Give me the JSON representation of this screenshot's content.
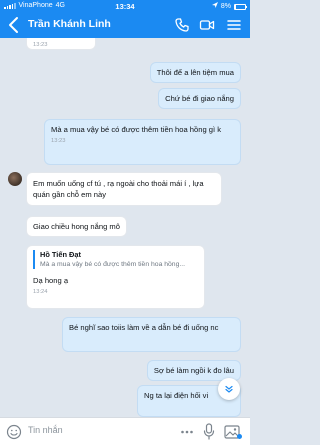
{
  "status_bar": {
    "carrier": "VinaPhone",
    "network": "4G",
    "time": "13:34",
    "battery": "8%",
    "battery_level": 0.08
  },
  "header": {
    "contact_name": "Trần Khánh Linh"
  },
  "messages": [
    {
      "text": "",
      "time": "13:23"
    },
    {
      "text": "Thôi để a lên tiệm mua",
      "time": ""
    },
    {
      "text": "Chứ bé đi giao nắng",
      "time": ""
    },
    {
      "text": "Mà a mua vậy bé có được thêm tiền hoa hồng gì k",
      "time": "13:23"
    },
    {
      "text": "Em muốn uống cf tú , rạ ngoài cho thoải mái í , lựa quán gần chỗ em này",
      "time": ""
    },
    {
      "text": "Giao chiều hong nắng mô",
      "time": ""
    },
    {
      "quote_author": "Hồ Tiến Đạt",
      "quote_text": "Mà a mua vậy bé có được thêm tiền hoa hồng...",
      "text": "Dạ hong ạ",
      "time": "13:24"
    },
    {
      "text": "Bé nghĩ sao toiis làm về a dẫn bé đi uống nc",
      "time": ""
    },
    {
      "text": "Sợ bé làm ngồi k đo lâu",
      "time": ""
    },
    {
      "text": "Ng ta lại điện hối vi",
      "time": ""
    }
  ],
  "input": {
    "placeholder": "Tin nhắn"
  },
  "colors": {
    "header_bg": "#1b8af2",
    "sent_bubble": "#d9ecfc",
    "received_bubble": "#ffffff",
    "chat_bg": "#dfe6ee"
  }
}
